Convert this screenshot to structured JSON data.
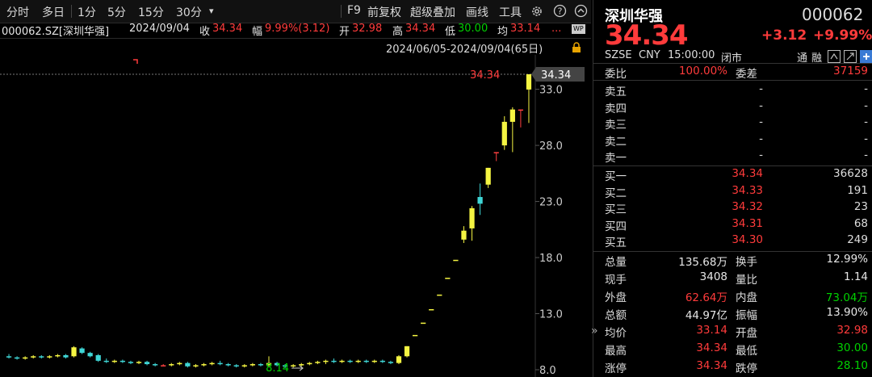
{
  "toolbar": {
    "items_left": [
      "分时",
      "多日",
      "1分",
      "5分",
      "15分",
      "30分"
    ],
    "dropdown_glyph": "▾",
    "items_right": [
      "F9",
      "前复权",
      "超级叠加",
      "画线",
      "工具"
    ],
    "settings_icon": "gear-icon",
    "help_icon": "help-icon",
    "expand_icon": "chevron-up-icon",
    "close_icon": "close-icon"
  },
  "info": {
    "code_name": "000062.SZ[深圳华强]",
    "date": "2024/09/04",
    "close_label": "收",
    "close_value": "34.34",
    "amp_label": "幅",
    "amp_value": "9.99%(3.12)",
    "open_label": "开",
    "open_value": "32.98",
    "high_label": "高",
    "high_value": "34.34",
    "low_label": "低",
    "low_value": "30.00",
    "avg_label": "均",
    "avg_value": "33.14",
    "more": "...",
    "wp_badge": "WP"
  },
  "range": {
    "text": "2024/06/05-2024/09/04(65日)",
    "lock_icon": "lock-icon"
  },
  "chart_data": {
    "type": "candlestick",
    "y_ticks": [
      "33.0",
      "28.0",
      "23.0",
      "18.0",
      "13.0",
      "8.0"
    ],
    "ylim": [
      8.0,
      34.34
    ],
    "last_price_label": "34.34",
    "last_price_tag": "34.34",
    "min_label": "8.14",
    "candles": [
      {
        "o": 9.2,
        "h": 9.4,
        "l": 9.0,
        "c": 9.1
      },
      {
        "o": 9.1,
        "h": 9.2,
        "l": 8.9,
        "c": 9.0
      },
      {
        "o": 9.0,
        "h": 9.2,
        "l": 8.9,
        "c": 9.1
      },
      {
        "o": 9.1,
        "h": 9.3,
        "l": 9.0,
        "c": 9.2
      },
      {
        "o": 9.2,
        "h": 9.3,
        "l": 9.0,
        "c": 9.1
      },
      {
        "o": 9.1,
        "h": 9.3,
        "l": 9.0,
        "c": 9.2
      },
      {
        "o": 9.2,
        "h": 9.4,
        "l": 9.1,
        "c": 9.3
      },
      {
        "o": 9.3,
        "h": 9.4,
        "l": 9.0,
        "c": 9.1
      },
      {
        "o": 9.2,
        "h": 10.1,
        "l": 9.1,
        "c": 10.0
      },
      {
        "o": 9.9,
        "h": 10.0,
        "l": 9.4,
        "c": 9.5
      },
      {
        "o": 9.5,
        "h": 9.6,
        "l": 9.1,
        "c": 9.2
      },
      {
        "o": 9.3,
        "h": 9.4,
        "l": 8.7,
        "c": 8.8
      },
      {
        "o": 8.8,
        "h": 9.0,
        "l": 8.6,
        "c": 8.7
      },
      {
        "o": 8.7,
        "h": 8.9,
        "l": 8.6,
        "c": 8.8
      },
      {
        "o": 8.8,
        "h": 8.9,
        "l": 8.6,
        "c": 8.7
      },
      {
        "o": 8.7,
        "h": 8.8,
        "l": 8.5,
        "c": 8.6
      },
      {
        "o": 8.6,
        "h": 8.8,
        "l": 8.5,
        "c": 8.7
      },
      {
        "o": 8.7,
        "h": 8.8,
        "l": 8.4,
        "c": 8.5
      },
      {
        "o": 8.5,
        "h": 8.6,
        "l": 8.3,
        "c": 8.4
      },
      {
        "o": 8.4,
        "h": 8.5,
        "l": 8.3,
        "c": 8.4
      },
      {
        "o": 8.4,
        "h": 8.6,
        "l": 8.3,
        "c": 8.5
      },
      {
        "o": 8.5,
        "h": 8.7,
        "l": 8.4,
        "c": 8.6
      },
      {
        "o": 8.6,
        "h": 8.7,
        "l": 8.2,
        "c": 8.3
      },
      {
        "o": 8.3,
        "h": 8.5,
        "l": 8.2,
        "c": 8.4
      },
      {
        "o": 8.4,
        "h": 8.6,
        "l": 8.3,
        "c": 8.5
      },
      {
        "o": 8.5,
        "h": 8.7,
        "l": 8.4,
        "c": 8.6
      },
      {
        "o": 8.6,
        "h": 8.8,
        "l": 8.4,
        "c": 8.5
      },
      {
        "o": 8.5,
        "h": 8.6,
        "l": 8.3,
        "c": 8.4
      },
      {
        "o": 8.4,
        "h": 8.5,
        "l": 8.2,
        "c": 8.3
      },
      {
        "o": 8.3,
        "h": 8.5,
        "l": 8.2,
        "c": 8.4
      },
      {
        "o": 8.4,
        "h": 8.6,
        "l": 8.3,
        "c": 8.5
      },
      {
        "o": 8.5,
        "h": 8.6,
        "l": 8.3,
        "c": 8.4
      },
      {
        "o": 8.4,
        "h": 9.2,
        "l": 8.3,
        "c": 8.6
      },
      {
        "o": 8.6,
        "h": 8.7,
        "l": 8.3,
        "c": 8.4
      },
      {
        "o": 8.4,
        "h": 8.5,
        "l": 8.14,
        "c": 8.3
      },
      {
        "o": 8.3,
        "h": 8.5,
        "l": 8.2,
        "c": 8.4
      },
      {
        "o": 8.4,
        "h": 8.6,
        "l": 8.3,
        "c": 8.5
      },
      {
        "o": 8.5,
        "h": 8.7,
        "l": 8.4,
        "c": 8.6
      },
      {
        "o": 8.6,
        "h": 8.8,
        "l": 8.5,
        "c": 8.7
      },
      {
        "o": 8.7,
        "h": 8.9,
        "l": 8.5,
        "c": 8.8
      },
      {
        "o": 8.8,
        "h": 9.0,
        "l": 8.6,
        "c": 8.7
      },
      {
        "o": 8.7,
        "h": 8.9,
        "l": 8.6,
        "c": 8.8
      },
      {
        "o": 8.8,
        "h": 8.9,
        "l": 8.6,
        "c": 8.7
      },
      {
        "o": 8.7,
        "h": 8.9,
        "l": 8.6,
        "c": 8.8
      },
      {
        "o": 8.8,
        "h": 8.9,
        "l": 8.6,
        "c": 8.7
      },
      {
        "o": 8.7,
        "h": 8.9,
        "l": 8.6,
        "c": 8.8
      },
      {
        "o": 8.8,
        "h": 8.9,
        "l": 8.6,
        "c": 8.7
      },
      {
        "o": 8.7,
        "h": 8.8,
        "l": 8.5,
        "c": 8.6
      },
      {
        "o": 8.6,
        "h": 9.3,
        "l": 8.5,
        "c": 9.2
      },
      {
        "o": 9.2,
        "h": 10.1,
        "l": 9.1,
        "c": 10.1
      },
      {
        "o": 11.1,
        "h": 11.1,
        "l": 11.1,
        "c": 11.1
      },
      {
        "o": 12.2,
        "h": 12.2,
        "l": 12.2,
        "c": 12.2
      },
      {
        "o": 13.4,
        "h": 13.4,
        "l": 13.4,
        "c": 13.4
      },
      {
        "o": 14.7,
        "h": 14.7,
        "l": 14.7,
        "c": 14.7
      },
      {
        "o": 16.2,
        "h": 16.2,
        "l": 16.2,
        "c": 16.2
      },
      {
        "o": 17.8,
        "h": 17.8,
        "l": 17.8,
        "c": 17.8
      },
      {
        "o": 19.6,
        "h": 20.8,
        "l": 19.3,
        "c": 20.4
      },
      {
        "o": 20.6,
        "h": 22.6,
        "l": 19.5,
        "c": 22.4
      },
      {
        "o": 23.4,
        "h": 24.6,
        "l": 21.8,
        "c": 22.8
      },
      {
        "o": 24.5,
        "h": 26.0,
        "l": 24.2,
        "c": 26.0
      },
      {
        "o": 27.4,
        "h": 27.4,
        "l": 26.6,
        "c": 27.4
      },
      {
        "o": 28.0,
        "h": 30.6,
        "l": 27.6,
        "c": 30.1
      },
      {
        "o": 30.1,
        "h": 31.4,
        "l": 27.4,
        "c": 31.2
      },
      {
        "o": 31.2,
        "h": 31.2,
        "l": 29.6,
        "c": 31.2
      },
      {
        "o": 32.98,
        "h": 34.34,
        "l": 30.0,
        "c": 34.34
      }
    ]
  },
  "side": {
    "name": "深圳华强",
    "code": "000062",
    "price": "34.34",
    "change": "+3.12",
    "change_pct": "+9.99%",
    "exchange": "SZSE",
    "currency": "CNY",
    "time": "15:00:00",
    "status": "闭市",
    "tong": "通",
    "rong": "融",
    "wei_bi_label": "委比",
    "wei_bi_value": "100.00%",
    "wei_cha_label": "委差",
    "wei_cha_value": "37159",
    "asks": [
      {
        "label": "卖五",
        "price": "-",
        "vol": "-"
      },
      {
        "label": "卖四",
        "price": "-",
        "vol": "-"
      },
      {
        "label": "卖三",
        "price": "-",
        "vol": "-"
      },
      {
        "label": "卖二",
        "price": "-",
        "vol": "-"
      },
      {
        "label": "卖一",
        "price": "-",
        "vol": "-"
      }
    ],
    "bids": [
      {
        "label": "买一",
        "price": "34.34",
        "vol": "36628"
      },
      {
        "label": "买二",
        "price": "34.33",
        "vol": "191"
      },
      {
        "label": "买三",
        "price": "34.32",
        "vol": "23"
      },
      {
        "label": "买四",
        "price": "34.31",
        "vol": "68"
      },
      {
        "label": "买五",
        "price": "34.30",
        "vol": "249"
      }
    ],
    "stats": [
      {
        "l1": "总量",
        "v1": "135.68万",
        "c1": "white",
        "l2": "换手",
        "v2": "12.99%",
        "c2": "white"
      },
      {
        "l1": "现手",
        "v1": "3408",
        "c1": "white",
        "l2": "量比",
        "v2": "1.14",
        "c2": "white"
      },
      {
        "l1": "外盘",
        "v1": "62.64万",
        "c1": "red",
        "l2": "内盘",
        "v2": "73.04万",
        "c2": "green"
      },
      {
        "l1": "总额",
        "v1": "44.97亿",
        "c1": "white",
        "l2": "振幅",
        "v2": "13.90%",
        "c2": "white"
      },
      {
        "l1": "均价",
        "v1": "33.14",
        "c1": "red",
        "l2": "开盘",
        "v2": "32.98",
        "c2": "red"
      },
      {
        "l1": "最高",
        "v1": "34.34",
        "c1": "red",
        "l2": "最低",
        "v2": "30.00",
        "c2": "green"
      },
      {
        "l1": "涨停",
        "v1": "34.34",
        "c1": "red",
        "l2": "跌停",
        "v2": "28.10",
        "c2": "green"
      }
    ],
    "collapse_glyph": "»"
  },
  "colors": {
    "up": "#f5f542",
    "down": "#3fd6d6",
    "flat": "#ff4040",
    "price_red": "#ff3b3b"
  }
}
